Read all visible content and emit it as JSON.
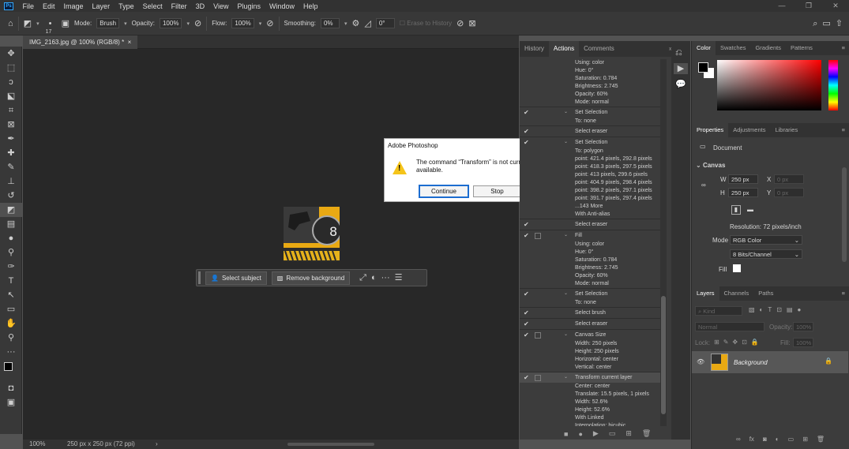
{
  "menu": {
    "items": [
      "File",
      "Edit",
      "Image",
      "Layer",
      "Type",
      "Select",
      "Filter",
      "3D",
      "View",
      "Plugins",
      "Window",
      "Help"
    ]
  },
  "options": {
    "brush_size": "17",
    "mode_label": "Mode:",
    "mode_value": "Brush",
    "opacity_label": "Opacity:",
    "opacity_value": "100%",
    "flow_label": "Flow:",
    "flow_value": "100%",
    "smoothing_label": "Smoothing:",
    "smoothing_value": "0%",
    "angle_value": "0°",
    "erase_history": "Erase to History"
  },
  "document": {
    "tab_title": "IMG_2163.jpg @ 100% (RGB/8) *",
    "zoom": "100%",
    "size_info": "250 px x 250 px (72 ppi)"
  },
  "contextbar": {
    "select_subject": "Select subject",
    "remove_background": "Remove background"
  },
  "dialog": {
    "title": "Adobe Photoshop",
    "message": "The command “Transform” is not currently available.",
    "continue": "Continue",
    "stop": "Stop"
  },
  "actions_panel": {
    "tabs": [
      "History",
      "Actions",
      "Comments"
    ],
    "rows": [
      {
        "t": "sub",
        "label": "Using: color"
      },
      {
        "t": "sub",
        "label": "Hue: 0°"
      },
      {
        "t": "sub",
        "label": "Saturation: 0.784"
      },
      {
        "t": "sub",
        "label": "Brightness: 2.745"
      },
      {
        "t": "sub",
        "label": "Opacity: 60%"
      },
      {
        "t": "sub",
        "label": "Mode: normal"
      },
      {
        "t": "head",
        "label": "Set Selection",
        "check": true,
        "twist": true
      },
      {
        "t": "sub",
        "label": "To: none"
      },
      {
        "t": "head",
        "label": "Select eraser",
        "check": true
      },
      {
        "t": "head",
        "label": "Set Selection",
        "check": true,
        "twist": true
      },
      {
        "t": "sub",
        "label": "To: polygon"
      },
      {
        "t": "sub",
        "label": "point: 421.4 pixels, 292.8 pixels"
      },
      {
        "t": "sub",
        "label": "point: 418.3 pixels, 297.5 pixels"
      },
      {
        "t": "sub",
        "label": "point: 413 pixels, 299.6 pixels"
      },
      {
        "t": "sub",
        "label": "point: 404.9 pixels, 298.4 pixels"
      },
      {
        "t": "sub",
        "label": "point: 398.2 pixels, 297.1 pixels"
      },
      {
        "t": "sub",
        "label": "point: 391.7 pixels, 297.4 pixels"
      },
      {
        "t": "sub",
        "label": "...143 More"
      },
      {
        "t": "sub",
        "label": "With Anti-alias"
      },
      {
        "t": "head",
        "label": "Select eraser",
        "check": true
      },
      {
        "t": "head",
        "label": "Fill",
        "check": true,
        "box": true,
        "twist": true
      },
      {
        "t": "sub",
        "label": "Using: color"
      },
      {
        "t": "sub",
        "label": "Hue: 0°"
      },
      {
        "t": "sub",
        "label": "Saturation: 0.784"
      },
      {
        "t": "sub",
        "label": "Brightness: 2.745"
      },
      {
        "t": "sub",
        "label": "Opacity: 60%"
      },
      {
        "t": "sub",
        "label": "Mode: normal"
      },
      {
        "t": "head",
        "label": "Set Selection",
        "check": true,
        "twist": true
      },
      {
        "t": "sub",
        "label": "To: none"
      },
      {
        "t": "head",
        "label": "Select brush",
        "check": true
      },
      {
        "t": "head",
        "label": "Select eraser",
        "check": true
      },
      {
        "t": "head",
        "label": "Canvas Size",
        "check": true,
        "box": true,
        "twist": true
      },
      {
        "t": "sub",
        "label": "Width: 250 pixels"
      },
      {
        "t": "sub",
        "label": "Height: 250 pixels"
      },
      {
        "t": "sub",
        "label": "Horizontal: center"
      },
      {
        "t": "sub",
        "label": "Vertical: center"
      },
      {
        "t": "head",
        "label": "Transform current layer",
        "check": true,
        "box": true,
        "twist": true,
        "hl": true
      },
      {
        "t": "sub",
        "label": "Center: center"
      },
      {
        "t": "sub",
        "label": "Translate: 15.5 pixels, 1 pixels"
      },
      {
        "t": "sub",
        "label": "Width: 52.6%"
      },
      {
        "t": "sub",
        "label": "Height: 52.6%"
      },
      {
        "t": "sub",
        "label": "With Linked"
      },
      {
        "t": "sub",
        "label": "Interpolation: bicubic"
      }
    ]
  },
  "color_panel": {
    "tabs": [
      "Color",
      "Swatches",
      "Gradients",
      "Patterns"
    ]
  },
  "properties_panel": {
    "tabs": [
      "Properties",
      "Adjustments",
      "Libraries"
    ],
    "doc_label": "Document",
    "canvas_label": "Canvas",
    "w_label": "W",
    "w_value": "250 px",
    "h_label": "H",
    "h_value": "250 px",
    "x_label": "X",
    "x_placeholder": "0 px",
    "y_label": "Y",
    "y_placeholder": "0 px",
    "resolution": "Resolution: 72 pixels/inch",
    "mode_label": "Mode",
    "mode_value": "RGB Color",
    "bits_value": "8 Bits/Channel",
    "fill_label": "Fill"
  },
  "layers_panel": {
    "tabs": [
      "Layers",
      "Channels",
      "Paths"
    ],
    "kind": "Kind",
    "blend": "Normal",
    "opacity_label": "Opacity:",
    "opacity_value": "100%",
    "lock_label": "Lock:",
    "fill_label": "Fill:",
    "fill_value": "100%",
    "layer_name": "Background"
  }
}
